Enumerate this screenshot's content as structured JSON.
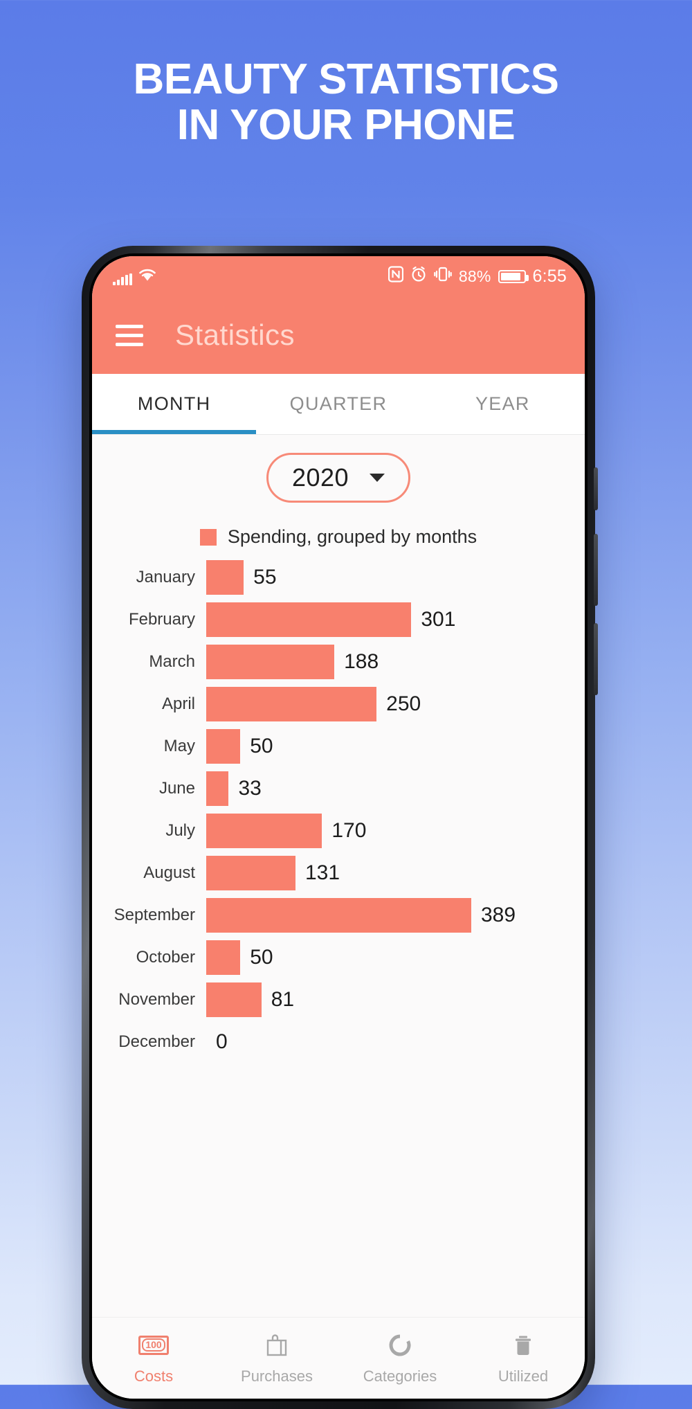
{
  "promo": {
    "headline_line1": "BEAUTY STATISTICS",
    "headline_line2": "IN YOUR PHONE"
  },
  "statusbar": {
    "signal_icon": "signal-bars-icon",
    "wifi_icon": "wifi-icon",
    "nfc_icon": "nfc-icon",
    "alarm_icon": "alarm-icon",
    "vibrate_icon": "vibrate-icon",
    "battery_percent": "88%",
    "battery_icon": "battery-icon",
    "clock": "6:55"
  },
  "appbar": {
    "menu_icon": "hamburger-menu-icon",
    "title": "Statistics"
  },
  "tabs": [
    {
      "label": "MONTH",
      "active": true
    },
    {
      "label": "QUARTER",
      "active": false
    },
    {
      "label": "YEAR",
      "active": false
    }
  ],
  "year_selector": {
    "value": "2020",
    "caret_icon": "chevron-down-icon"
  },
  "legend": {
    "swatch_color": "#f8806d",
    "label": "Spending, grouped by months"
  },
  "chart_data": {
    "type": "bar",
    "orientation": "horizontal",
    "title": "Spending, grouped by months",
    "xlabel": "",
    "ylabel": "",
    "categories": [
      "January",
      "February",
      "March",
      "April",
      "May",
      "June",
      "July",
      "August",
      "September",
      "October",
      "November",
      "December"
    ],
    "values": [
      55,
      301,
      188,
      250,
      50,
      33,
      170,
      131,
      389,
      50,
      81,
      0
    ],
    "series": [
      {
        "name": "Spending, grouped by months",
        "color": "#f8806d",
        "values": [
          55,
          301,
          188,
          250,
          50,
          33,
          170,
          131,
          389,
          50,
          81,
          0
        ]
      }
    ],
    "xlim": [
      0,
      389
    ],
    "grid": false,
    "legend_position": "top-center",
    "data_labels": [
      "55",
      "301",
      "188",
      "250",
      "50",
      "33",
      "170",
      "131",
      "389",
      "50",
      "81",
      "0"
    ]
  },
  "bottom_nav": [
    {
      "label": "Costs",
      "icon": "money-banknote-icon",
      "icon_text": "100",
      "active": true
    },
    {
      "label": "Purchases",
      "icon": "shopping-bag-icon",
      "active": false
    },
    {
      "label": "Categories",
      "icon": "donut-chart-icon",
      "active": false
    },
    {
      "label": "Utilized",
      "icon": "trash-bin-icon",
      "active": false
    }
  ],
  "colors": {
    "accent": "#f8816e",
    "tab_indicator": "#2a8fc4",
    "background_top": "#5b7ce8",
    "background_bottom": "#e3ecfc"
  }
}
